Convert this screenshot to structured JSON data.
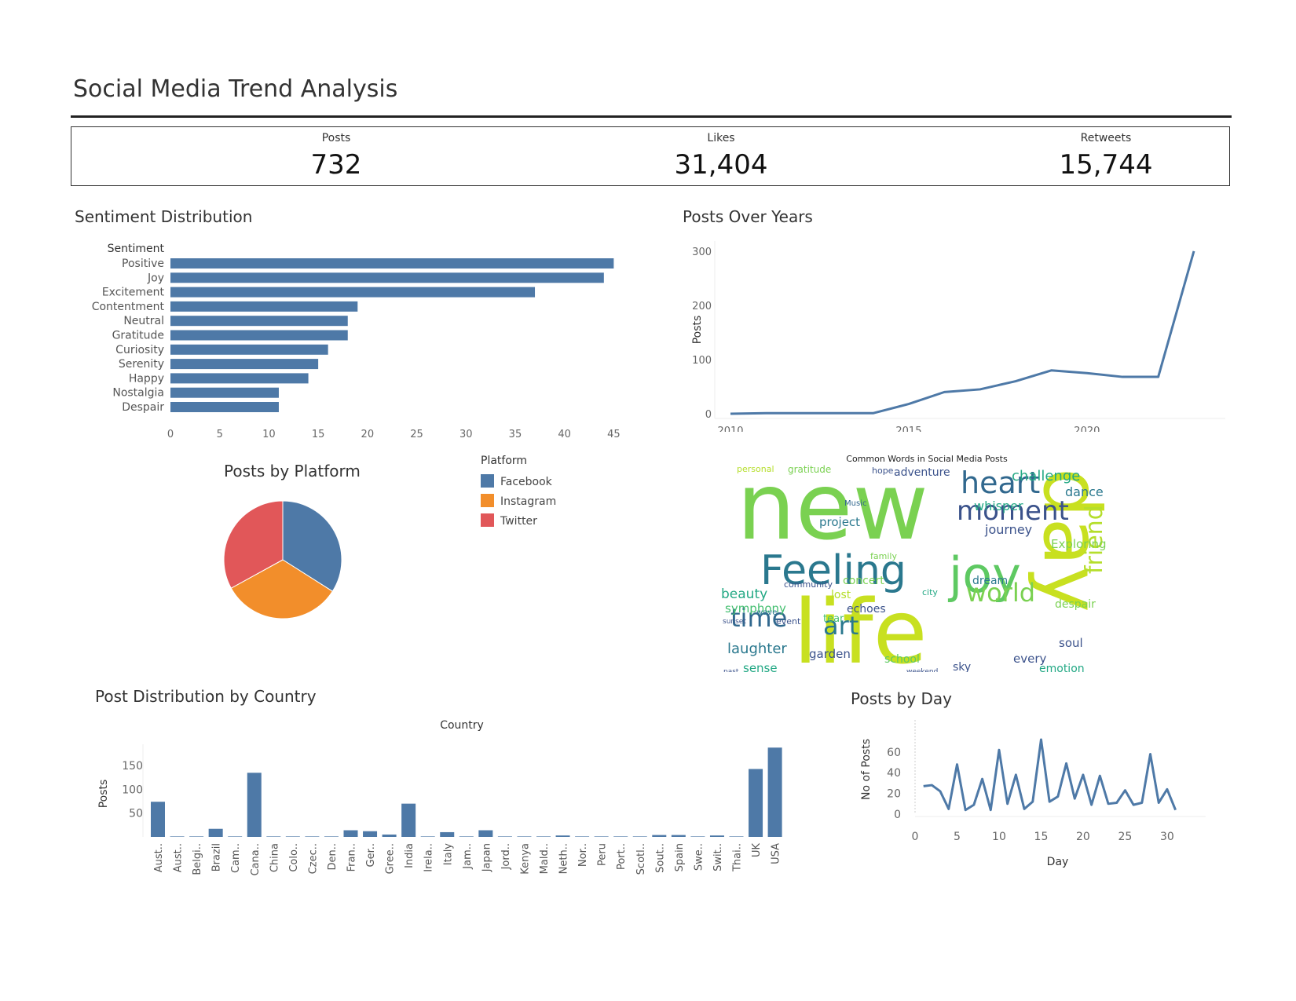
{
  "title": "Social Media Trend Analysis",
  "kpis": [
    {
      "label": "Posts",
      "value": "732"
    },
    {
      "label": "Likes",
      "value": "31,404"
    },
    {
      "label": "Retweets",
      "value": "15,744"
    }
  ],
  "sections": {
    "sentiment": "Sentiment Distribution",
    "years": "Posts Over Years",
    "platform": "Posts by Platform",
    "country": "Post Distribution by Country",
    "day": "Posts by Day"
  },
  "colors": {
    "bar": "#4e79a7",
    "facebook": "#4e79a7",
    "instagram": "#f28e2b",
    "twitter": "#e15759"
  },
  "chart_data": [
    {
      "id": "sentiment",
      "type": "bar",
      "orientation": "horizontal",
      "title": "Sentiment Distribution",
      "category_header": "Sentiment",
      "categories": [
        "Positive",
        "Joy",
        "Excitement",
        "Contentment",
        "Neutral",
        "Gratitude",
        "Curiosity",
        "Serenity",
        "Happy",
        "Nostalgia",
        "Despair"
      ],
      "values": [
        45,
        44,
        37,
        19,
        18,
        18,
        16,
        15,
        14,
        11,
        11
      ],
      "xlim": [
        0,
        48
      ],
      "xticks": [
        0,
        5,
        10,
        15,
        20,
        25,
        30,
        35,
        40,
        45
      ]
    },
    {
      "id": "years",
      "type": "line",
      "title": "Posts Over Years",
      "ylabel": "Posts",
      "x": [
        2010,
        2011,
        2012,
        2013,
        2014,
        2015,
        2016,
        2017,
        2018,
        2019,
        2020,
        2021,
        2022,
        2023
      ],
      "values": [
        0,
        1,
        1,
        1,
        1,
        18,
        40,
        45,
        60,
        80,
        75,
        68,
        68,
        300
      ],
      "ylim": [
        0,
        310
      ],
      "yticks": [
        0,
        100,
        200,
        300
      ],
      "xticks": [
        2010,
        2015,
        2020
      ]
    },
    {
      "id": "platform",
      "type": "pie",
      "title": "Posts by Platform",
      "legend_title": "Platform",
      "labels": [
        "Facebook",
        "Instagram",
        "Twitter"
      ],
      "values": [
        34,
        33,
        33
      ]
    },
    {
      "id": "wordcloud",
      "type": "other",
      "title": "Common Words in Social Media Posts",
      "words": [
        {
          "text": "new",
          "size": 118,
          "color": "#7ad151"
        },
        {
          "text": "life",
          "size": 112,
          "color": "#c8e020"
        },
        {
          "text": "day",
          "size": 100,
          "color": "#c8e020"
        },
        {
          "text": "Feeling",
          "size": 52,
          "color": "#2a788e"
        },
        {
          "text": "joy",
          "size": 62,
          "color": "#5ec962"
        },
        {
          "text": "heart",
          "size": 38,
          "color": "#31688e"
        },
        {
          "text": "moment",
          "size": 34,
          "color": "#3b528b"
        },
        {
          "text": "world",
          "size": 32,
          "color": "#7ad151"
        },
        {
          "text": "time",
          "size": 32,
          "color": "#31688e"
        },
        {
          "text": "art",
          "size": 32,
          "color": "#2a788e"
        },
        {
          "text": "friend",
          "size": 30,
          "color": "#b5de2b"
        },
        {
          "text": "challenge",
          "size": 18,
          "color": "#22a884"
        },
        {
          "text": "dance",
          "size": 16,
          "color": "#2a788e"
        },
        {
          "text": "whisper",
          "size": 16,
          "color": "#22a884"
        },
        {
          "text": "journey",
          "size": 16,
          "color": "#3b528b"
        },
        {
          "text": "project",
          "size": 15,
          "color": "#2a788e"
        },
        {
          "text": "adventure",
          "size": 14,
          "color": "#3b528b"
        },
        {
          "text": "beauty",
          "size": 17,
          "color": "#22a884"
        },
        {
          "text": "laughter",
          "size": 18,
          "color": "#2a788e"
        },
        {
          "text": "symphony",
          "size": 15,
          "color": "#44bf70"
        },
        {
          "text": "garden",
          "size": 15,
          "color": "#3b528b"
        },
        {
          "text": "echoes",
          "size": 14,
          "color": "#3b528b"
        },
        {
          "text": "concert",
          "size": 14,
          "color": "#7ad151"
        },
        {
          "text": "soul",
          "size": 15,
          "color": "#3b528b"
        },
        {
          "text": "every",
          "size": 15,
          "color": "#3b528b"
        },
        {
          "text": "sense",
          "size": 15,
          "color": "#22a884"
        },
        {
          "text": "school",
          "size": 14,
          "color": "#5ec962"
        },
        {
          "text": "sky",
          "size": 14,
          "color": "#3b528b"
        },
        {
          "text": "emotion",
          "size": 14,
          "color": "#22a884"
        },
        {
          "text": "despair",
          "size": 14,
          "color": "#7ad151"
        },
        {
          "text": "dream",
          "size": 14,
          "color": "#2a788e"
        },
        {
          "text": "Exploring",
          "size": 15,
          "color": "#7ad151"
        },
        {
          "text": "lost",
          "size": 14,
          "color": "#b5de2b"
        },
        {
          "text": "tear",
          "size": 13,
          "color": "#44bf70"
        },
        {
          "text": "gratitude",
          "size": 12,
          "color": "#7ad151"
        },
        {
          "text": "personal",
          "size": 11,
          "color": "#b5de2b"
        },
        {
          "text": "hope",
          "size": 11,
          "color": "#3b528b"
        },
        {
          "text": "Music",
          "size": 10,
          "color": "#31688e"
        },
        {
          "text": "family",
          "size": 11,
          "color": "#7ad151"
        },
        {
          "text": "community",
          "size": 11,
          "color": "#3b528b"
        },
        {
          "text": "city",
          "size": 11,
          "color": "#22a884"
        },
        {
          "text": "event",
          "size": 11,
          "color": "#3b528b"
        },
        {
          "text": "wave",
          "size": 10,
          "color": "#2a788e"
        },
        {
          "text": "weekend",
          "size": 9,
          "color": "#3b528b"
        },
        {
          "text": "past",
          "size": 9,
          "color": "#3b528b"
        },
        {
          "text": "sunset",
          "size": 9,
          "color": "#3b528b"
        }
      ]
    },
    {
      "id": "country",
      "type": "bar",
      "title": "Post Distribution by Country",
      "header": "Country",
      "ylabel": "Posts",
      "categories": [
        "Aust..",
        "Aust..",
        "Belgi..",
        "Brazil",
        "Cam..",
        "Cana..",
        "China",
        "Colo..",
        "Czec..",
        "Den..",
        "Fran..",
        "Ger..",
        "Gree..",
        "India",
        "Irela..",
        "Italy",
        "Jam..",
        "Japan",
        "Jord..",
        "Kenya",
        "Mald..",
        "Neth..",
        "Nor..",
        "Peru",
        "Port..",
        "Scotl..",
        "Sout..",
        "Spain",
        "Swe..",
        "Swit..",
        "Thai..",
        "UK",
        "USA"
      ],
      "values": [
        74,
        1,
        1,
        17,
        1,
        135,
        1,
        1,
        1,
        1,
        14,
        12,
        5,
        70,
        1,
        10,
        1,
        14,
        1,
        1,
        1,
        3,
        1,
        1,
        1,
        1,
        4,
        4,
        1,
        3,
        1,
        143,
        188
      ],
      "ylim": [
        0,
        195
      ],
      "yticks": [
        50,
        100,
        150
      ]
    },
    {
      "id": "day",
      "type": "line",
      "title": "Posts by Day",
      "xlabel": "Day",
      "ylabel": "No of Posts",
      "x": [
        1,
        2,
        3,
        4,
        5,
        6,
        7,
        8,
        9,
        10,
        11,
        12,
        13,
        14,
        15,
        16,
        17,
        18,
        19,
        20,
        21,
        22,
        23,
        24,
        25,
        26,
        27,
        28,
        29,
        30,
        31
      ],
      "values": [
        27,
        28,
        22,
        5,
        48,
        4,
        9,
        34,
        4,
        62,
        10,
        38,
        5,
        12,
        72,
        12,
        17,
        49,
        15,
        38,
        9,
        37,
        10,
        11,
        23,
        9,
        11,
        58,
        11,
        24,
        4
      ],
      "xlim": [
        0,
        33
      ],
      "ylim": [
        0,
        72
      ],
      "xticks": [
        0,
        5,
        10,
        15,
        20,
        25,
        30
      ],
      "yticks": [
        0,
        20,
        40,
        60
      ]
    }
  ]
}
